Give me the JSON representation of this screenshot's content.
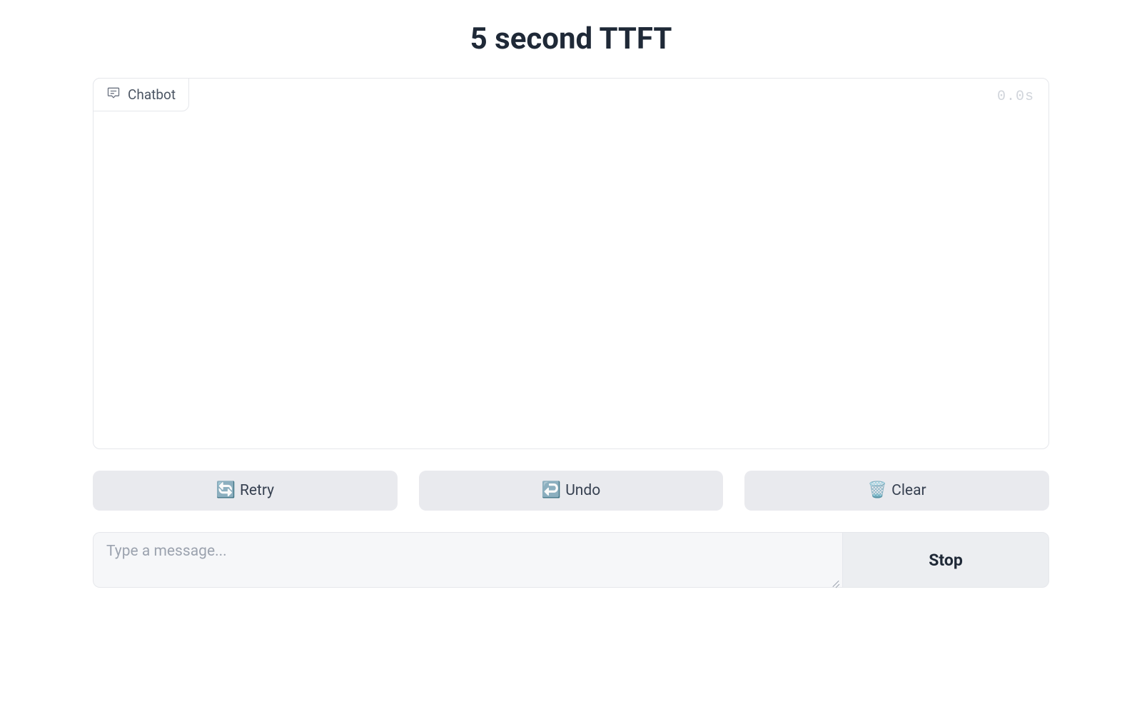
{
  "title": "5 second TTFT",
  "chat": {
    "tab_label": "Chatbot",
    "timer": "0.0s"
  },
  "actions": {
    "retry": {
      "icon": "🔄",
      "label": "Retry"
    },
    "undo": {
      "icon": "↩️",
      "label": "Undo"
    },
    "clear": {
      "icon": "🗑️",
      "label": "Clear"
    }
  },
  "input": {
    "placeholder": "Type a message...",
    "value": ""
  },
  "stop_label": "Stop"
}
